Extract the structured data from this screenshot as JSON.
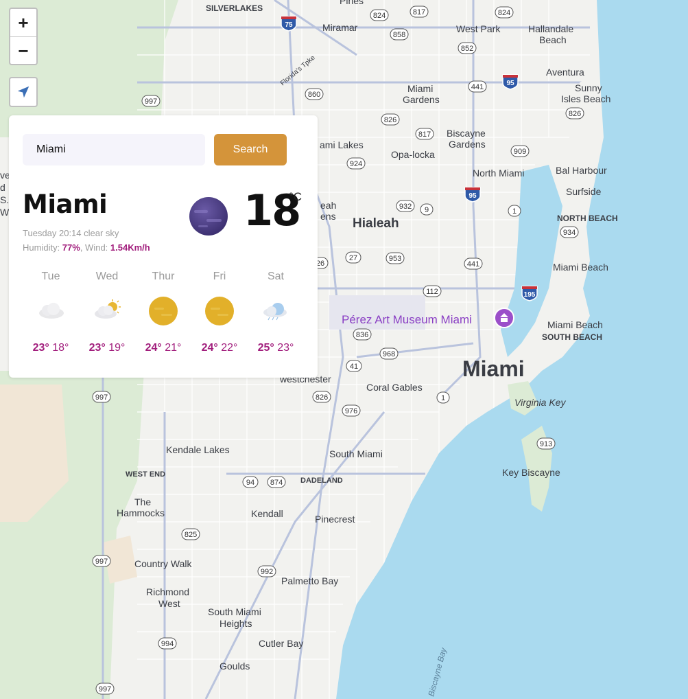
{
  "controls": {
    "zoom_in": "+",
    "zoom_out": "−"
  },
  "weather": {
    "search": {
      "value": "Miami",
      "button": "Search"
    },
    "city": "Miami",
    "description": "Tuesday 20:14 clear sky",
    "humidity_label": "Humidity: ",
    "humidity": "77%",
    "wind_label": ", Wind: ",
    "wind": "1.54Km/h",
    "temperature": "18",
    "unit": "°C",
    "current_icon": "moon-icon",
    "forecast": [
      {
        "day": "Tue",
        "hi": "23°",
        "lo": "18°",
        "icon": "cloud-icon"
      },
      {
        "day": "Wed",
        "hi": "23°",
        "lo": "19°",
        "icon": "partly-cloudy-icon"
      },
      {
        "day": "Thur",
        "hi": "24°",
        "lo": "21°",
        "icon": "sun-icon"
      },
      {
        "day": "Fri",
        "hi": "24°",
        "lo": "22°",
        "icon": "sun-icon"
      },
      {
        "day": "Sat",
        "hi": "25°",
        "lo": "23°",
        "icon": "light-rain-icon"
      }
    ]
  },
  "map": {
    "places": [
      "SILVERLAKES",
      "Pines",
      "Miramar",
      "West Park",
      "Hallandale",
      "Beach",
      "Aventura",
      "Sunny",
      "Isles Beach",
      "Miami",
      "Gardens",
      "Biscayne",
      "Gardens",
      "ami Lakes",
      "Opa-locka",
      "North Miami",
      "Bal Harbour",
      "Surfside",
      "NORTH BEACH",
      "Hialeah",
      "eah",
      "ens",
      "Miami Beach",
      "Pérez Art Museum Miami",
      "Miami Beach",
      "SOUTH BEACH",
      "Miami",
      "westchester",
      "Coral Gables",
      "Virginia Key",
      "Kendale Lakes",
      "South Miami",
      "WEST END",
      "DADELAND",
      "Key Biscayne",
      "The",
      "Hammocks",
      "Kendall",
      "Pinecrest",
      "Country Walk",
      "Palmetto Bay",
      "Richmond",
      "West",
      "South Miami",
      "Heights",
      "Cutler Bay",
      "Goulds",
      "Biscayne Bay",
      "Florida's Tpke",
      "ve",
      "d",
      "S.",
      "Wi"
    ],
    "shields": [
      "824",
      "817",
      "824",
      "858",
      "852",
      "441",
      "95",
      "860",
      "997",
      "826",
      "817",
      "826",
      "909",
      "924",
      "95",
      "932",
      "9",
      "1",
      "934",
      "27",
      "953",
      "441",
      "26",
      "112",
      "195",
      "836",
      "968",
      "41",
      "826",
      "1",
      "976",
      "997",
      "913",
      "94",
      "874",
      "825",
      "997",
      "992",
      "994",
      "997",
      "75"
    ]
  }
}
